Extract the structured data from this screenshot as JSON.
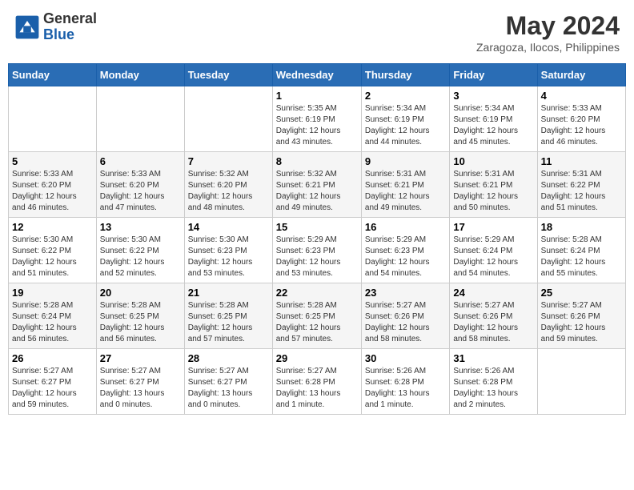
{
  "header": {
    "logo_general": "General",
    "logo_blue": "Blue",
    "month_year": "May 2024",
    "location": "Zaragoza, Ilocos, Philippines"
  },
  "weekdays": [
    "Sunday",
    "Monday",
    "Tuesday",
    "Wednesday",
    "Thursday",
    "Friday",
    "Saturday"
  ],
  "weeks": [
    [
      {
        "day": "",
        "info": ""
      },
      {
        "day": "",
        "info": ""
      },
      {
        "day": "",
        "info": ""
      },
      {
        "day": "1",
        "info": "Sunrise: 5:35 AM\nSunset: 6:19 PM\nDaylight: 12 hours\nand 43 minutes."
      },
      {
        "day": "2",
        "info": "Sunrise: 5:34 AM\nSunset: 6:19 PM\nDaylight: 12 hours\nand 44 minutes."
      },
      {
        "day": "3",
        "info": "Sunrise: 5:34 AM\nSunset: 6:19 PM\nDaylight: 12 hours\nand 45 minutes."
      },
      {
        "day": "4",
        "info": "Sunrise: 5:33 AM\nSunset: 6:20 PM\nDaylight: 12 hours\nand 46 minutes."
      }
    ],
    [
      {
        "day": "5",
        "info": "Sunrise: 5:33 AM\nSunset: 6:20 PM\nDaylight: 12 hours\nand 46 minutes."
      },
      {
        "day": "6",
        "info": "Sunrise: 5:33 AM\nSunset: 6:20 PM\nDaylight: 12 hours\nand 47 minutes."
      },
      {
        "day": "7",
        "info": "Sunrise: 5:32 AM\nSunset: 6:20 PM\nDaylight: 12 hours\nand 48 minutes."
      },
      {
        "day": "8",
        "info": "Sunrise: 5:32 AM\nSunset: 6:21 PM\nDaylight: 12 hours\nand 49 minutes."
      },
      {
        "day": "9",
        "info": "Sunrise: 5:31 AM\nSunset: 6:21 PM\nDaylight: 12 hours\nand 49 minutes."
      },
      {
        "day": "10",
        "info": "Sunrise: 5:31 AM\nSunset: 6:21 PM\nDaylight: 12 hours\nand 50 minutes."
      },
      {
        "day": "11",
        "info": "Sunrise: 5:31 AM\nSunset: 6:22 PM\nDaylight: 12 hours\nand 51 minutes."
      }
    ],
    [
      {
        "day": "12",
        "info": "Sunrise: 5:30 AM\nSunset: 6:22 PM\nDaylight: 12 hours\nand 51 minutes."
      },
      {
        "day": "13",
        "info": "Sunrise: 5:30 AM\nSunset: 6:22 PM\nDaylight: 12 hours\nand 52 minutes."
      },
      {
        "day": "14",
        "info": "Sunrise: 5:30 AM\nSunset: 6:23 PM\nDaylight: 12 hours\nand 53 minutes."
      },
      {
        "day": "15",
        "info": "Sunrise: 5:29 AM\nSunset: 6:23 PM\nDaylight: 12 hours\nand 53 minutes."
      },
      {
        "day": "16",
        "info": "Sunrise: 5:29 AM\nSunset: 6:23 PM\nDaylight: 12 hours\nand 54 minutes."
      },
      {
        "day": "17",
        "info": "Sunrise: 5:29 AM\nSunset: 6:24 PM\nDaylight: 12 hours\nand 54 minutes."
      },
      {
        "day": "18",
        "info": "Sunrise: 5:28 AM\nSunset: 6:24 PM\nDaylight: 12 hours\nand 55 minutes."
      }
    ],
    [
      {
        "day": "19",
        "info": "Sunrise: 5:28 AM\nSunset: 6:24 PM\nDaylight: 12 hours\nand 56 minutes."
      },
      {
        "day": "20",
        "info": "Sunrise: 5:28 AM\nSunset: 6:25 PM\nDaylight: 12 hours\nand 56 minutes."
      },
      {
        "day": "21",
        "info": "Sunrise: 5:28 AM\nSunset: 6:25 PM\nDaylight: 12 hours\nand 57 minutes."
      },
      {
        "day": "22",
        "info": "Sunrise: 5:28 AM\nSunset: 6:25 PM\nDaylight: 12 hours\nand 57 minutes."
      },
      {
        "day": "23",
        "info": "Sunrise: 5:27 AM\nSunset: 6:26 PM\nDaylight: 12 hours\nand 58 minutes."
      },
      {
        "day": "24",
        "info": "Sunrise: 5:27 AM\nSunset: 6:26 PM\nDaylight: 12 hours\nand 58 minutes."
      },
      {
        "day": "25",
        "info": "Sunrise: 5:27 AM\nSunset: 6:26 PM\nDaylight: 12 hours\nand 59 minutes."
      }
    ],
    [
      {
        "day": "26",
        "info": "Sunrise: 5:27 AM\nSunset: 6:27 PM\nDaylight: 12 hours\nand 59 minutes."
      },
      {
        "day": "27",
        "info": "Sunrise: 5:27 AM\nSunset: 6:27 PM\nDaylight: 13 hours\nand 0 minutes."
      },
      {
        "day": "28",
        "info": "Sunrise: 5:27 AM\nSunset: 6:27 PM\nDaylight: 13 hours\nand 0 minutes."
      },
      {
        "day": "29",
        "info": "Sunrise: 5:27 AM\nSunset: 6:28 PM\nDaylight: 13 hours\nand 1 minute."
      },
      {
        "day": "30",
        "info": "Sunrise: 5:26 AM\nSunset: 6:28 PM\nDaylight: 13 hours\nand 1 minute."
      },
      {
        "day": "31",
        "info": "Sunrise: 5:26 AM\nSunset: 6:28 PM\nDaylight: 13 hours\nand 2 minutes."
      },
      {
        "day": "",
        "info": ""
      }
    ]
  ]
}
